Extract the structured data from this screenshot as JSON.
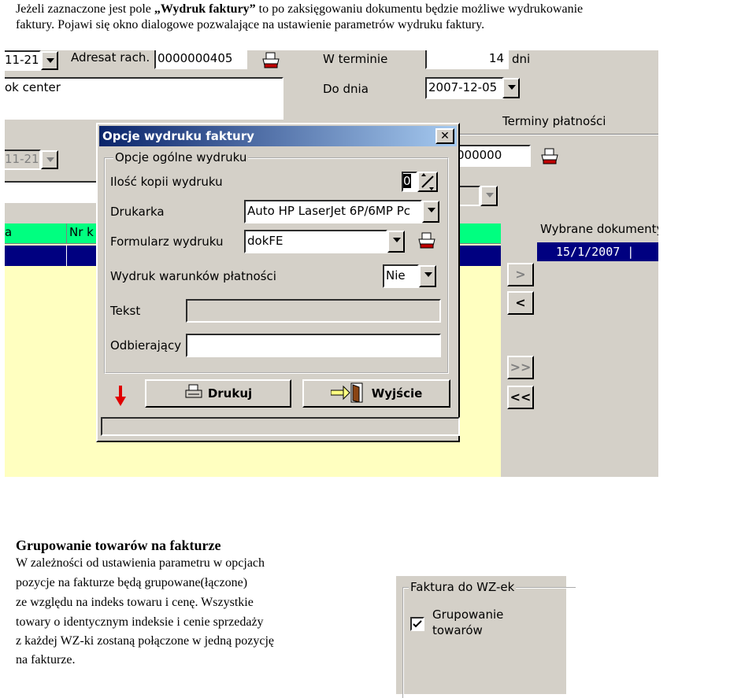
{
  "intro": {
    "line1_a": "Jeżeli zaznaczone jest pole ",
    "line1_b": "„Wydruk faktury”",
    "line1_c": " to po zaksięgowaniu dokumentu będzie możliwe wydrukowanie",
    "line2": "faktury. Pojawi się okno dialogowe pozwalające na ustawienie parametrów wydruku faktury."
  },
  "background_form": {
    "date_fragment_1": "11-21",
    "adresat_label": "Adresat rach.",
    "adresat_value": "0000000405",
    "w_terminie_label": "W terminie",
    "w_terminie_value": "14",
    "dni_label": "dni",
    "center_text": "ok center",
    "do_dnia_label": "Do dnia",
    "do_dnia_value": "2007-12-05",
    "terminy_label": "Terminy płatności",
    "date_fragment_2": "11-21",
    "number_fragment": "000000",
    "grid_col_a": "a",
    "grid_col_nr": "Nr k",
    "wybrane_label": "Wybrane dokumenty",
    "selected_date": "15/1/2007  |",
    "nav_buttons": [
      ">",
      "<",
      ">>",
      "<<"
    ]
  },
  "dialog": {
    "title": "Opcje wydruku faktury",
    "close_glyph": "✕",
    "group_title": "Opcje ogólne wydruku",
    "copies_label": "Ilość kopii wydruku",
    "copies_value": "0",
    "printer_label": "Drukarka",
    "printer_value": "Auto HP LaserJet 6P/6MP Pc",
    "form_label": "Formularz wydruku",
    "form_value": "dokFE",
    "payment_terms_label": "Wydruk warunków płatności",
    "payment_terms_value": "Nie",
    "text_label": "Tekst",
    "text_value": "",
    "receiver_label": "Odbierający",
    "receiver_value": "",
    "print_button": "Drukuj",
    "exit_button": "Wyjście"
  },
  "section2": {
    "heading": "Grupowanie towarów na fakturze",
    "para_lines": [
      "W zależności od ustawienia parametru w opcjach",
      "pozycje na fakturze będą grupowane(łączone)",
      "ze względu  na indeks towaru i cenę. Wszystkie",
      "towary o identycznym indeksie i cenie sprzedaży",
      "z każdej WZ-ki zostaną połączone w  jedną pozycję",
      "na fakturze."
    ]
  },
  "option_panel": {
    "group_title": "Faktura do WZ-ek",
    "checkbox_label_1": "Grupowanie",
    "checkbox_label_2": "towarów",
    "checked": true
  },
  "colors": {
    "window_bg": "#d4d0c8",
    "title_start": "#0a246a",
    "title_end": "#a6caf0",
    "grid_yellow": "#ffffc0",
    "grid_header": "#00ff80",
    "selection": "#000080",
    "arrow_red": "#e00000"
  }
}
